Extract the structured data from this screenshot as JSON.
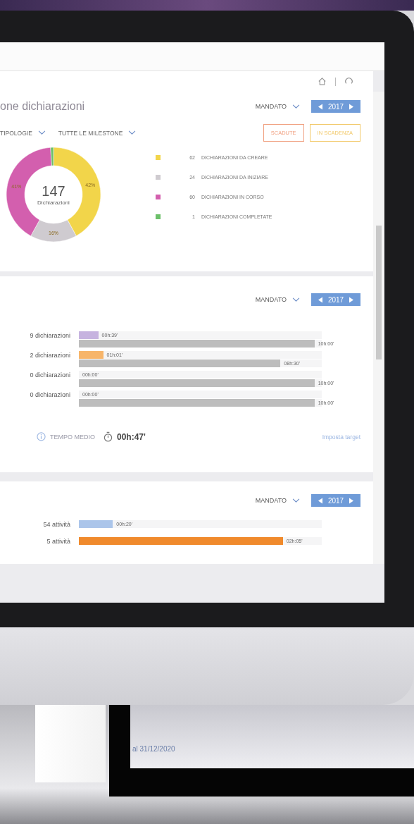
{
  "declarations_panel": {
    "title": "one dichiarazioni",
    "period_filter": "MANDATO",
    "year": "2017",
    "filters": [
      "TIPOLOGIE",
      "TUTTE LE MILESTONE"
    ],
    "status_buttons": [
      {
        "label": "SCADUTE",
        "color": "#f0a080"
      },
      {
        "label": "IN SCADENZA",
        "color": "#f2c96a"
      }
    ],
    "total": "147",
    "total_label": "Dichiarazioni",
    "chart_data": {
      "type": "donut",
      "values": [
        42,
        16,
        41,
        1
      ],
      "value_labels": [
        "42%",
        "16%",
        "41%",
        null
      ]
    },
    "legend": [
      {
        "count": "62",
        "label": "DICHIARAZIONI DA CREARE",
        "color": "#f2d54a"
      },
      {
        "count": "24",
        "label": "DICHIARAZIONI DA INIZIARE",
        "color": "#cfcbd0"
      },
      {
        "count": "60",
        "label": "DICHIARAZIONI IN CORSO",
        "color": "#d35fae"
      },
      {
        "count": "1",
        "label": "DICHIARAZIONI COMPLETATE",
        "color": "#6cc06a"
      }
    ]
  },
  "times_panel": {
    "period_filter": "MANDATO",
    "year": "2017",
    "rows": [
      {
        "label": "9 dichiarazioni",
        "color": "#c6b3df",
        "bar": {
          "level": 0.08,
          "text": "00h:39'"
        },
        "target": {
          "level": 0.97,
          "text": "10h:00'"
        }
      },
      {
        "label": "2 dichiarazioni",
        "color": "#f7b56a",
        "bar": {
          "level": 0.1,
          "text": "01h:01'"
        },
        "target": {
          "level": 0.83,
          "text": "08h:30'"
        }
      },
      {
        "label": "0 dichiarazioni",
        "bar": {
          "text": "00h:00'"
        },
        "target": {
          "level": 0.97,
          "text": "10h:00'"
        }
      },
      {
        "label": "0 dichiarazioni",
        "bar": {
          "text": "00h:00'"
        },
        "target": {
          "level": 0.97,
          "text": "10h:00'"
        }
      }
    ],
    "average_label": "TEMPO MEDIO",
    "average": "00h:47'",
    "target_link": "Imposta target"
  },
  "activities_panel": {
    "period_filter": "MANDATO",
    "year": "2017",
    "rows": [
      {
        "label": "54 attività",
        "color": "#abc5ea",
        "bar": {
          "level": 0.14,
          "text": "00h:20'"
        }
      },
      {
        "label": "5 attività",
        "color": "#f08a2c",
        "bar": {
          "level": 0.84,
          "text": "02h:05'"
        }
      }
    ]
  },
  "second_screen": {
    "date_text": "al 31/12/2020"
  }
}
